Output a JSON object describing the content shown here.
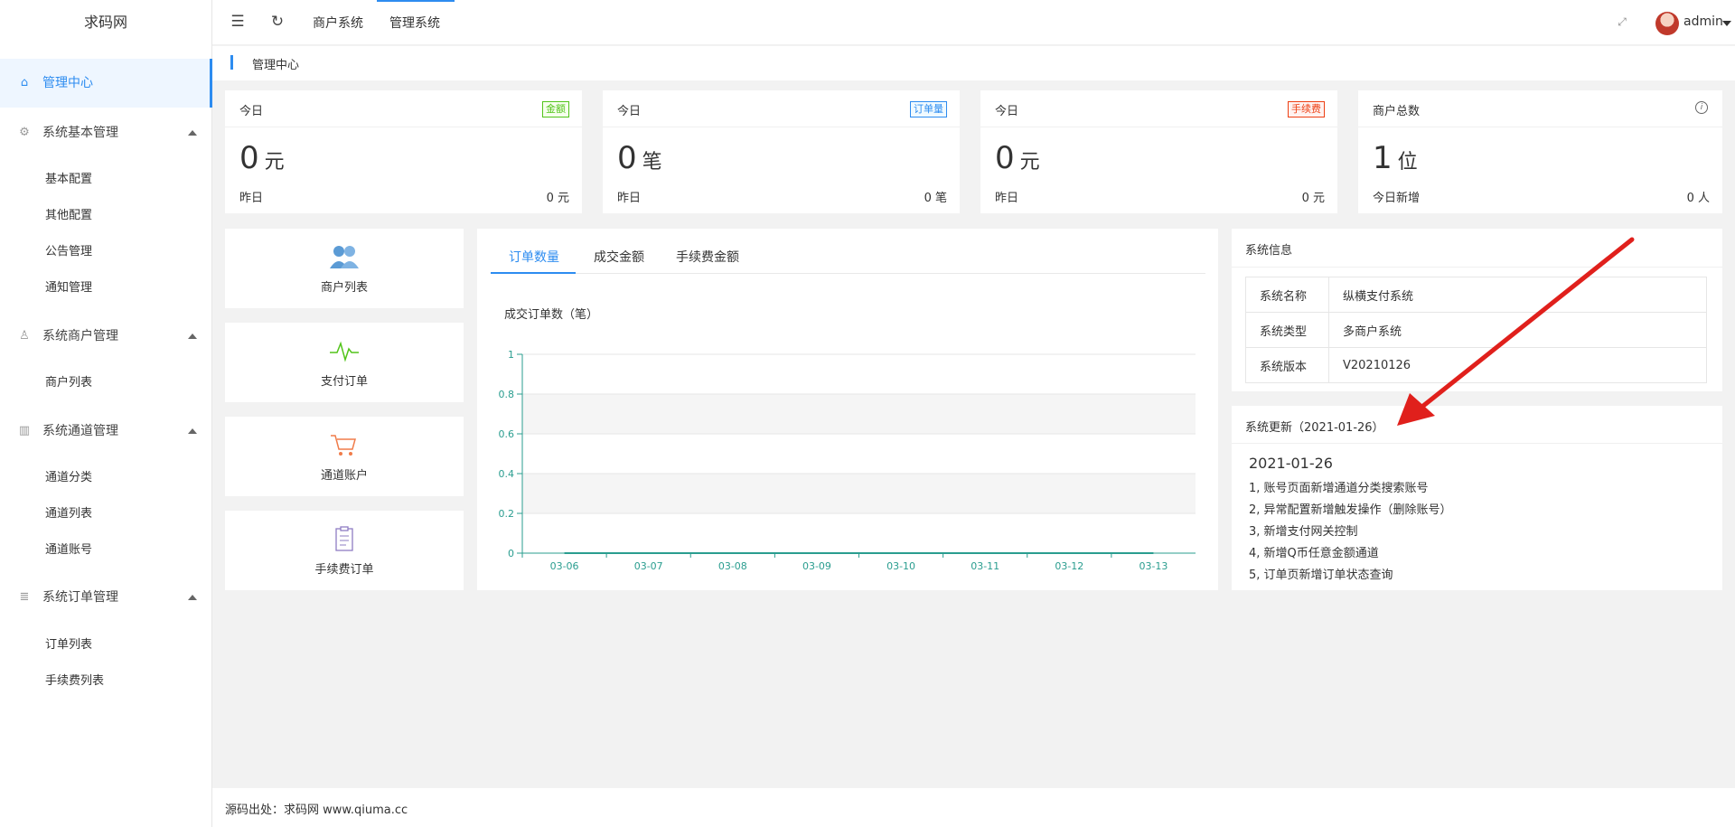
{
  "app": {
    "title": "求码网"
  },
  "header": {
    "links": [
      "商户系统",
      "管理系统"
    ],
    "user": "admin"
  },
  "breadcrumb": "管理中心",
  "sidebar": {
    "home": "管理中心",
    "groups": [
      {
        "label": "系统基本管理",
        "items": [
          "基本配置",
          "其他配置",
          "公告管理",
          "通知管理"
        ]
      },
      {
        "label": "系统商户管理",
        "items": [
          "商户列表"
        ]
      },
      {
        "label": "系统通道管理",
        "items": [
          "通道分类",
          "通道列表",
          "通道账号"
        ]
      },
      {
        "label": "系统订单管理",
        "items": [
          "订单列表",
          "手续费列表"
        ]
      }
    ]
  },
  "stats": [
    {
      "label": "今日",
      "badge": "金额",
      "badge_color": "#52c41a",
      "value": "0",
      "unit": "元",
      "foot_label": "昨日",
      "foot_value": "0 元"
    },
    {
      "label": "今日",
      "badge": "订单量",
      "badge_color": "#2d8cf0",
      "value": "0",
      "unit": "笔",
      "foot_label": "昨日",
      "foot_value": "0 笔"
    },
    {
      "label": "今日",
      "badge": "手续费",
      "badge_color": "#ed4014",
      "value": "0",
      "unit": "元",
      "foot_label": "昨日",
      "foot_value": "0 元"
    },
    {
      "label": "商户总数",
      "badge": "",
      "value": "1",
      "unit": "位",
      "foot_label": "今日新增",
      "foot_value": "0 人"
    }
  ],
  "quick_links": [
    "商户列表",
    "支付订单",
    "通道账户",
    "手续费订单"
  ],
  "tabs": [
    "订单数量",
    "成交金额",
    "手续费金额"
  ],
  "chart_data": {
    "type": "line",
    "title": "成交订单数（笔）",
    "categories": [
      "03-06",
      "03-07",
      "03-08",
      "03-09",
      "03-10",
      "03-11",
      "03-12",
      "03-13"
    ],
    "values": [
      0,
      0,
      0,
      0,
      0,
      0,
      0,
      0
    ],
    "y_ticks": [
      "0",
      "0.2",
      "0.4",
      "0.6",
      "0.8",
      "1"
    ],
    "ylim": [
      0,
      1
    ],
    "colors": {
      "axis": "#2a9d8f",
      "line": "#2a9d8f"
    }
  },
  "system_info": {
    "title": "系统信息",
    "rows": [
      {
        "k": "系统名称",
        "v": "纵横支付系统"
      },
      {
        "k": "系统类型",
        "v": "多商户系统"
      },
      {
        "k": "系统版本",
        "v": "V20210126"
      }
    ]
  },
  "system_update": {
    "title": "系统更新（2021-01-26）",
    "date": "2021-01-26",
    "lines": [
      "1, 账号页面新增通道分类搜索账号",
      "2, 异常配置新增触发操作（删除账号）",
      "3, 新增支付网关控制",
      "4, 新增Q币任意金额通道",
      "5, 订单页新增订单状态查询"
    ]
  },
  "footer": "源码出处：求码网 www.qiuma.cc"
}
